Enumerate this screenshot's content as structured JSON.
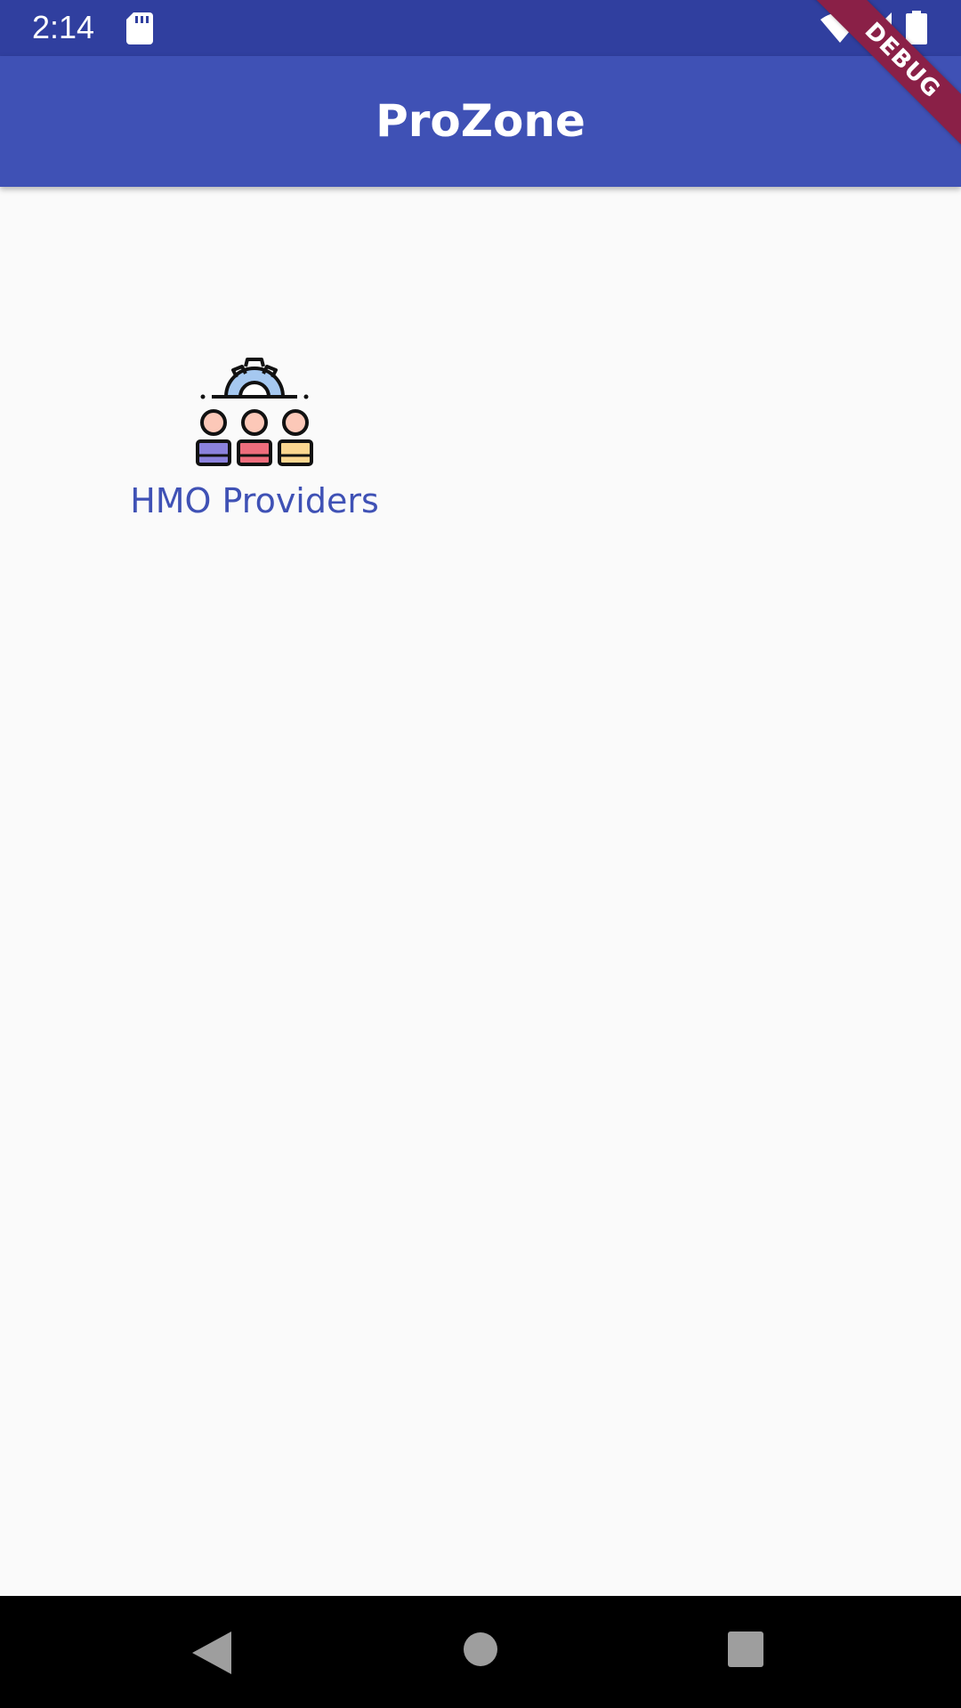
{
  "status_bar": {
    "time": "2:14",
    "icons": [
      "sd-card-icon",
      "wifi-icon",
      "signal-icon",
      "battery-icon"
    ]
  },
  "app_bar": {
    "title": "ProZone"
  },
  "debug_banner": {
    "label": "DEBUG"
  },
  "main": {
    "tiles": [
      {
        "label": "HMO Providers",
        "icon": "team-settings-icon"
      }
    ]
  },
  "nav_bar": {
    "icons": [
      "back-icon",
      "home-icon",
      "recent-apps-icon"
    ]
  },
  "colors": {
    "status_bar": "#303f9f",
    "app_bar": "#3f51b5",
    "background": "#fafafa",
    "tile_label": "#3f51b5",
    "debug_banner": "#8a2047",
    "nav_bar": "#000000"
  }
}
